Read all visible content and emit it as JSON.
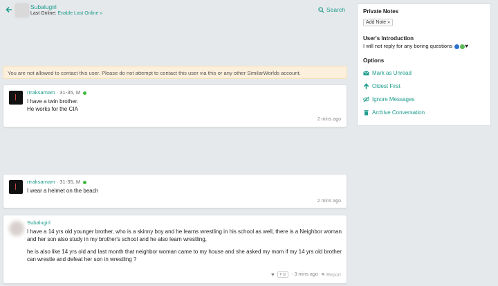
{
  "header": {
    "username": "Subalugirl",
    "last_online_label": "Last Online:",
    "last_online_link": "Enable Last Online »",
    "search_label": "Search"
  },
  "notice": {
    "text": "You are not allowed to contact this user. Please do not attempt to contact this user via this or any other SimilarWorlds account."
  },
  "messages": [
    {
      "sender": "rrraksamam",
      "meta": "· 31-35, M",
      "online": true,
      "lines": [
        "I have a twin brother.",
        "He works for the CIA"
      ],
      "time": "2 mins ago"
    },
    {
      "sender": "rrraksamam",
      "meta": "· 31-35, M",
      "online": true,
      "lines": [
        "I wear a helmet on the beach"
      ],
      "time": "2 mins ago"
    },
    {
      "sender": "Subalugirl",
      "paragraphs": [
        "I have a 14 yrs old younger brother, who is a skinny boy and he learns wrestling in his school as well, there is a Neighbor woman and her son also study in my brother's school and he also learn wrestling,",
        "he is also like 14 yrs old and last month that neighbor woman came to my house and she asked my mom if my 14 yrs old brother can wrestle and defeat her son in wrestling ?"
      ],
      "time": "· 3 mins ago",
      "react_label": "+☺",
      "report_label": "Report"
    }
  ],
  "sidebar": {
    "private_notes_title": "Private Notes",
    "add_note_label": "Add Note »",
    "intro_title": "User's Introduction",
    "intro_text": "I will not reply for any boring questions",
    "heart_colors": [
      "#2f6fd1",
      "#5cb85c",
      "#222222"
    ],
    "options_title": "Options",
    "options": [
      {
        "label": "Mark as Unread",
        "icon": "envelope-icon"
      },
      {
        "label": "Oldest First",
        "icon": "arrow-up-icon"
      },
      {
        "label": "Ignore Messages",
        "icon": "eye-slash-icon"
      },
      {
        "label": "Archive Conversation",
        "icon": "trash-icon"
      }
    ]
  },
  "colors": {
    "accent": "#1e9c8c",
    "online": "#3cba3c",
    "notice_bg": "#fcf0dc"
  }
}
